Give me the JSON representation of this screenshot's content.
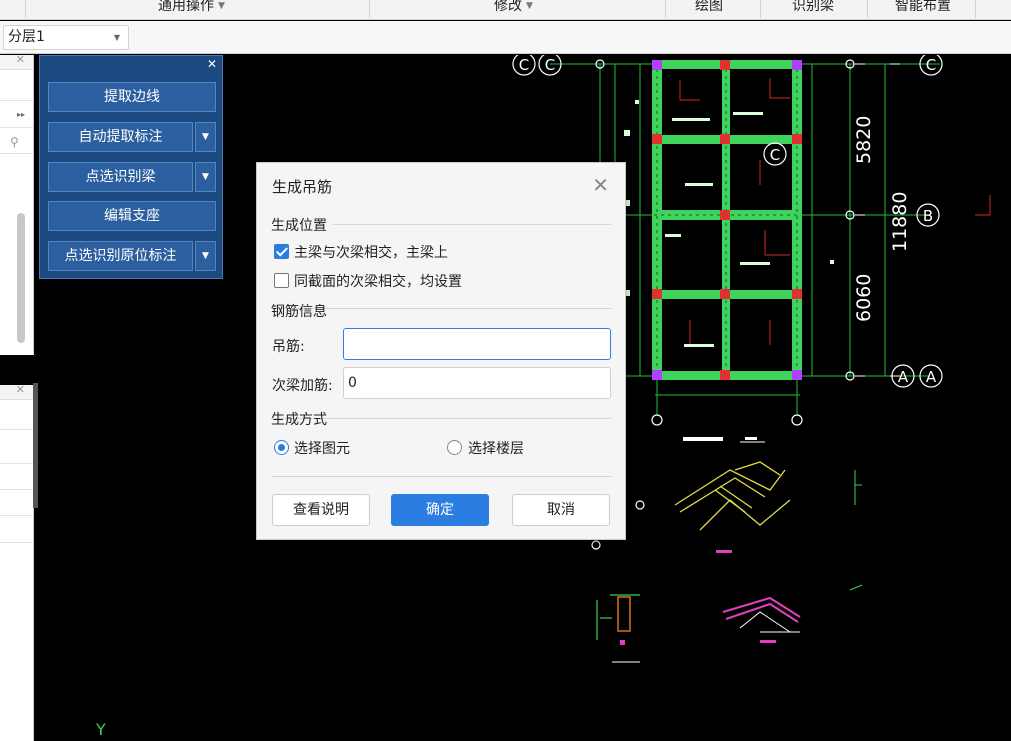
{
  "ribbon": {
    "groups": [
      {
        "label": "通用操作",
        "has_dropdown": true
      },
      {
        "label": "修改",
        "has_dropdown": true
      },
      {
        "label": "绘图",
        "has_dropdown": false
      },
      {
        "label": "识别梁",
        "has_dropdown": false
      },
      {
        "label": "智能布置",
        "has_dropdown": false
      }
    ]
  },
  "layer_select": {
    "value": "分层1"
  },
  "tool_panel": {
    "buttons": [
      {
        "label": "提取边线",
        "has_dropdown": false
      },
      {
        "label": "自动提取标注",
        "has_dropdown": true
      },
      {
        "label": "点选识别梁",
        "has_dropdown": true
      },
      {
        "label": "编辑支座",
        "has_dropdown": false
      },
      {
        "label": "点选识别原位标注",
        "has_dropdown": true
      }
    ]
  },
  "cad": {
    "axis_labels": {
      "c1": "C",
      "c2": "C",
      "c3": "C",
      "c4": "C",
      "b": "B",
      "a1": "A",
      "a2": "A",
      "a3": "A"
    },
    "dimensions": {
      "top": "5820",
      "total": "11880",
      "bottom": "6060"
    },
    "ucs_label": "Y",
    "colors": {
      "background": "#000000",
      "beam": "#39d353",
      "grid": "#00ff00",
      "column": "#e03030",
      "dim_text": "#ffffff"
    }
  },
  "dialog": {
    "title": "生成吊筋",
    "section_position": "生成位置",
    "option1": {
      "label": "主梁与次梁相交，主梁上",
      "checked": true
    },
    "option2": {
      "label": "同截面的次梁相交，均设置",
      "checked": false
    },
    "section_rebar": "钢筋信息",
    "hanger_label": "吊筋:",
    "hanger_value": "",
    "secondary_label": "次梁加筋:",
    "secondary_value": "0",
    "section_method": "生成方式",
    "radio1": {
      "label": "选择图元",
      "selected": true
    },
    "radio2": {
      "label": "选择楼层",
      "selected": false
    },
    "btn_help": "查看说明",
    "btn_ok": "确定",
    "btn_cancel": "取消"
  }
}
